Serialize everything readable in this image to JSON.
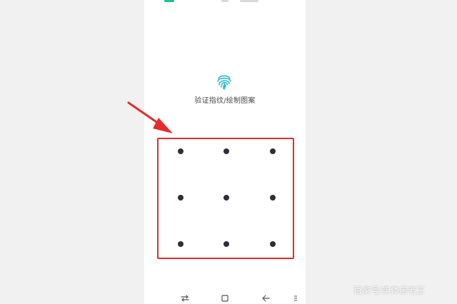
{
  "screen": {
    "prompt_text": "验证指纹/绘制图案"
  },
  "icons": {
    "fingerprint": "fingerprint-icon",
    "nav_recents": "swap-icon",
    "nav_home": "square-home-icon",
    "nav_back": "back-arrow-icon",
    "nav_menu": "menu-icon"
  },
  "pattern": {
    "rows": 3,
    "columns": 3
  },
  "watermark": "百家号/实体店老王",
  "colors": {
    "accent": "#19c2a0",
    "highlight": "#e32d2d",
    "dot": "#2f2f3a"
  }
}
